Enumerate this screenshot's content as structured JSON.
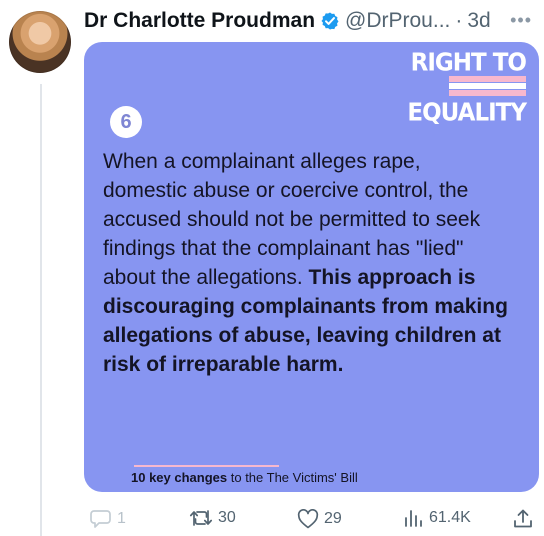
{
  "tweet": {
    "display_name": "Dr Charlotte Proudman",
    "handle": "@DrProu...",
    "separator": "·",
    "time": "3d"
  },
  "card": {
    "brand_top": "RIGHT TO",
    "brand_bottom": "EQUALITY",
    "number": "6",
    "body_normal": "When a complainant alleges rape, domestic abuse or coercive control, the accused should not be permitted to seek findings that the complainant has \"lied\" about the allegations. ",
    "body_bold": "This approach is discouraging complainants from making allegations of abuse, leaving children at risk of irreparable harm.",
    "footer_bold": "10 key changes",
    "footer_rest": " to the The Victims' Bill"
  },
  "actions": {
    "reply_count": "1",
    "retweet_count": "30",
    "like_count": "29",
    "views_count": "61.4K"
  },
  "icons": {
    "verified": "verified-badge-icon",
    "more": "more-icon",
    "reply": "reply-icon",
    "retweet": "retweet-icon",
    "like": "heart-icon",
    "views": "views-icon",
    "share": "share-icon"
  },
  "colors": {
    "card_background": "#8795f1",
    "verified": "#1d9bf0",
    "stripe_pink": "#f7b8ce"
  }
}
